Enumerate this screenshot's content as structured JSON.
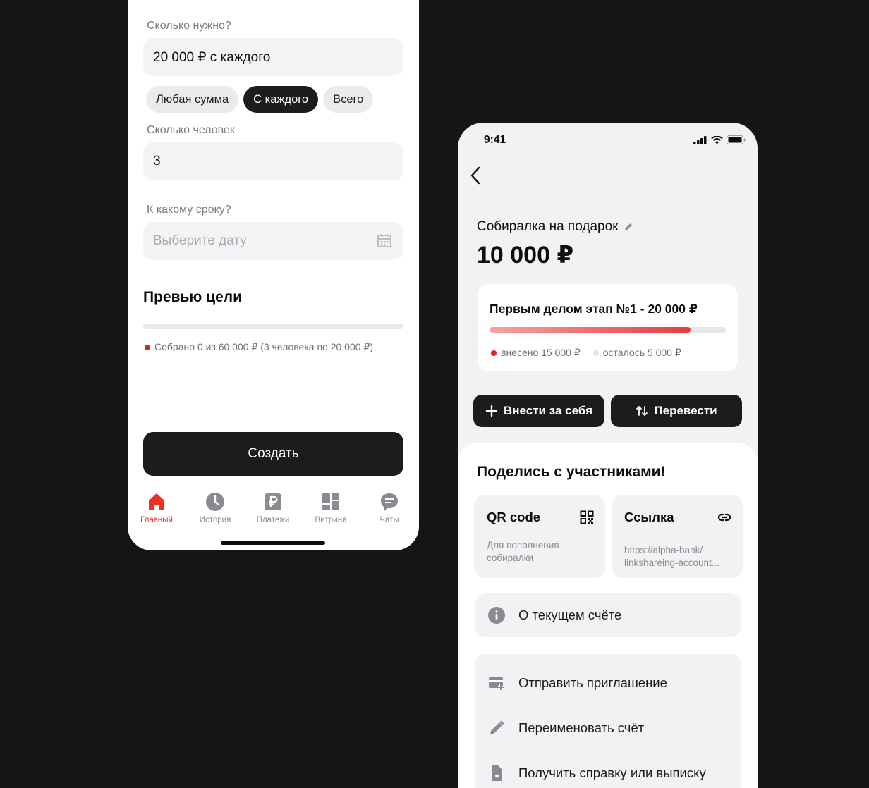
{
  "left_screen": {
    "amount_label": "Сколько нужно?",
    "amount_value": "20 000  ₽ с каждого",
    "chips": [
      "Любая сумма",
      "С каждого",
      "Всего"
    ],
    "people_label": "Сколько человек",
    "people_value": "3",
    "deadline_label": "К какому сроку?",
    "deadline_placeholder": "Выберите дату",
    "preview_title": "Превью цели",
    "collected_text": "Собрано 0 из 60 000 ₽ (3 человека по 20 000 ₽)",
    "collected_progress": 0,
    "create_label": "Создать",
    "tabs": [
      {
        "label": "Главный",
        "icon": "home-icon",
        "active": true
      },
      {
        "label": "История",
        "icon": "clock-icon",
        "active": false
      },
      {
        "label": "Платежи",
        "icon": "ruble-icon",
        "active": false
      },
      {
        "label": "Витрина",
        "icon": "showcase-icon",
        "active": false
      },
      {
        "label": "Чаты",
        "icon": "chat-icon",
        "active": false
      }
    ],
    "accent_color": "#ef3124"
  },
  "right_screen": {
    "status_time": "9:41",
    "goal_title": "Собиралка на подарок",
    "goal_amount": "10 000 ₽",
    "stage": {
      "title": "Первым делом этап №1 - 20 000 ₽",
      "progress": 0.85,
      "paid_text": "внесено 15 000 ₽",
      "left_text": "осталось 5 000 ₽"
    },
    "deposit_label": "Внести за себя",
    "transfer_label": "Перевести",
    "share_title": "Поделись с участниками!",
    "qr": {
      "title": "QR code",
      "subtitle": "Для пополнения собиралки"
    },
    "link": {
      "title": "Ссылка",
      "subtitle": "https://alpha-bank/ linkshareing-account..."
    },
    "about_label": "О текущем счёте",
    "actions": [
      "Отправить приглашение",
      "Переименовать счёт",
      "Получить справку или выписку"
    ]
  }
}
